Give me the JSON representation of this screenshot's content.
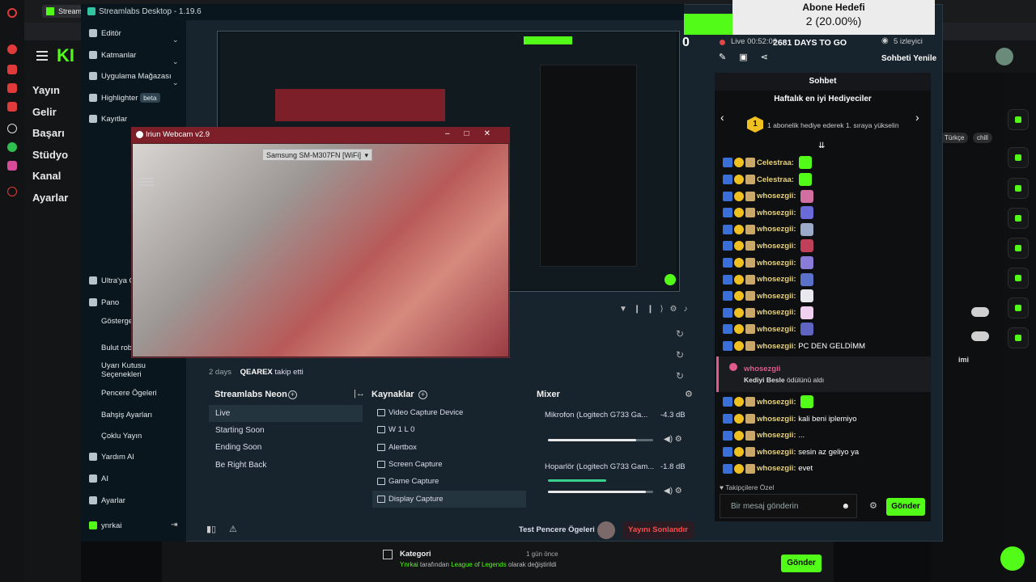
{
  "browser": {
    "tab_title": "Streamlabs",
    "browser_name": "Opera"
  },
  "kick_page": {
    "logo": "KI",
    "nav": [
      "Yayın",
      "Gelir",
      "Başarı",
      "Stüdyo",
      "Kanal",
      "Ayarlar"
    ],
    "tags": [
      "Türkçe",
      "chill"
    ],
    "side_label": "imi",
    "bottom_category": {
      "title": "Kategori",
      "time": "1 gün önce",
      "user": "Ynrkai",
      "mid_text": "tarafından",
      "game": "League of Legends",
      "end_text": "olarak değiştirildi"
    },
    "send_label": "Gönder"
  },
  "streamlabs": {
    "title": "Streamlabs Desktop - 1.19.6",
    "menu": [
      {
        "label": "Editör",
        "icon": "chevron"
      },
      {
        "label": "Katmanlar",
        "icon": "chevron"
      },
      {
        "label": "Uygulama Mağazası",
        "icon": "chevron"
      },
      {
        "label": "Highlighter",
        "badge": "beta"
      },
      {
        "label": "Kayıtlar"
      }
    ],
    "menu2": [
      "Ultra'ya G",
      "Pano",
      "Gösterge Sayfa",
      "Bulut rob",
      "Uyarı Kutusu Seçenekleri",
      "Pencere Ögeleri",
      "Bahşiş Ayarları",
      "Çoklu Yayın",
      "Yardım Al",
      "AI",
      "Ayarlar",
      "ynrkai"
    ],
    "activity": [
      {
        "time": "2 days",
        "user": "QEAREX",
        "action": "takip etti"
      }
    ],
    "scenes_title": "Streamlabs Neon",
    "scenes": [
      "Live",
      "Starting Soon",
      "Ending Soon",
      "Be Right Back"
    ],
    "sources_title": "Kaynaklar",
    "sources": [
      "Video Capture Device",
      "W 1 L 0",
      "Alertbox",
      "Screen Capture",
      "Game Capture",
      "Display Capture"
    ],
    "mixer_title": "Mixer",
    "mixer": [
      {
        "name": "Mikrofon (Logitech G733 Ga...",
        "db": "-4.3 dB",
        "level": 0.84
      },
      {
        "name": "Hoparlör (Logitech G733 Gam...",
        "db": "-1.8 dB",
        "level": 0.93
      }
    ],
    "footer": {
      "test": "Test Pencere Ögeleri",
      "end": "Yayını Sonlandır"
    }
  },
  "webcam": {
    "title": "Iriun Webcam v2.9",
    "device": "Samsung SM-M307FN [WiFi]"
  },
  "chat": {
    "goal_title": "Abone Hedefi",
    "goal_value": "2 (20.00%)",
    "goal_progress": 0.2,
    "days": "2681 DAYS TO GO",
    "live_time": "Live 00:52:06",
    "viewers": "5 izleyici",
    "score": "0",
    "refresh": "Sohbeti Yenile",
    "header": "Sohbet",
    "top_gifters": "Haftalık en iyi Hediyeciler",
    "gift_rank": "1",
    "gift_text": "1 abonelik hediye ederek 1. sıraya yükselin",
    "messages": [
      {
        "user": "Celestraa",
        "text": "",
        "emote": "#53fc18"
      },
      {
        "user": "Celestraa",
        "text": "",
        "emote": "#53fc18"
      },
      {
        "user": "whosezgii",
        "text": "",
        "emote": "#d06fa0"
      },
      {
        "user": "whosezgii",
        "text": "",
        "emote": "#6a6ad8"
      },
      {
        "user": "whosezgii",
        "text": "",
        "emote": "#9da9c8"
      },
      {
        "user": "whosezgii",
        "text": "",
        "emote": "#c0405a"
      },
      {
        "user": "whosezgii",
        "text": "",
        "emote": "#8b7bd8"
      },
      {
        "user": "whosezgii",
        "text": "",
        "emote": "#5a72c8"
      },
      {
        "user": "whosezgii",
        "text": "",
        "emote": "#e8e8ee"
      },
      {
        "user": "whosezgii",
        "text": "",
        "emote": "#f0d0f0"
      },
      {
        "user": "whosezgii",
        "text": "",
        "emote": "#5e64c0"
      },
      {
        "user": "whosezgii",
        "text": "PC DEN GELDİMM",
        "emote": ""
      }
    ],
    "reward": {
      "user": "whosezgii",
      "reward_name": "Kediyi Besle",
      "reward_text": "ödülünü aldı"
    },
    "messages2": [
      {
        "user": "whosezgii",
        "text": "",
        "emote": "#53fc18"
      },
      {
        "user": "whosezgii",
        "text": "kali beni iplemiyo",
        "emote": ""
      },
      {
        "user": "whosezgii",
        "text": "...",
        "emote": ""
      },
      {
        "user": "whosezgii",
        "text": "sesin az geliyo ya",
        "emote": ""
      },
      {
        "user": "whosezgii",
        "text": "evet",
        "emote": ""
      }
    ],
    "followers_only": "Takipçilere Özel",
    "input_placeholder": "Bir mesaj gönderin",
    "send": "Gönder"
  },
  "colors": {
    "accent": "#53fc18",
    "streamlabs_bg": "#17242d",
    "webcam_title": "#7c1f29",
    "end_stream": "#ff4a4a"
  }
}
